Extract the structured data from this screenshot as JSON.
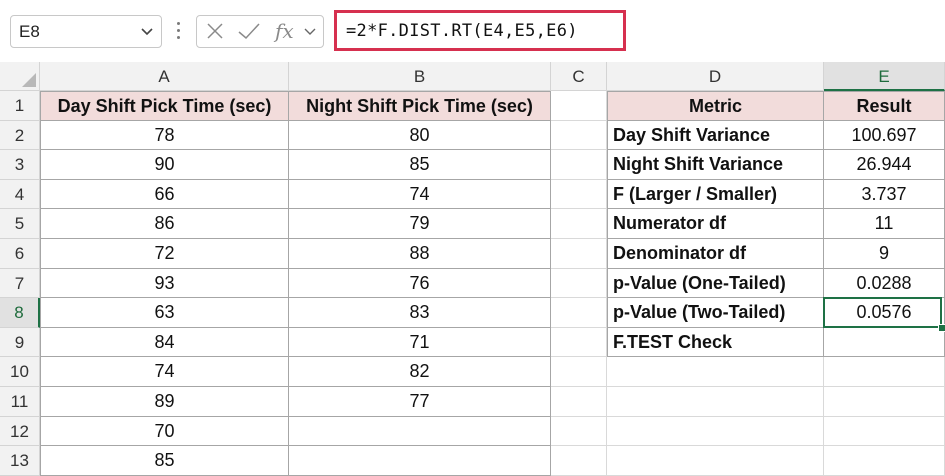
{
  "formula_bar": {
    "name_box": "E8",
    "cancel_icon": "cancel-icon",
    "enter_icon": "check-icon",
    "fx_label": "fx",
    "formula": "=2*F.DIST.RT(E4,E5,E6)",
    "highlight_color": "#d6304f"
  },
  "columns": [
    "A",
    "B",
    "C",
    "D",
    "E"
  ],
  "selected_column": "E",
  "rows": [
    "1",
    "2",
    "3",
    "4",
    "5",
    "6",
    "7",
    "8",
    "9",
    "10",
    "11",
    "12",
    "13"
  ],
  "selected_row": "8",
  "pick_times": {
    "header_a": "Day Shift Pick Time (sec)",
    "header_b": "Night Shift Pick Time (sec)",
    "day": [
      "78",
      "90",
      "66",
      "86",
      "72",
      "93",
      "63",
      "84",
      "74",
      "89",
      "70",
      "85"
    ],
    "night": [
      "80",
      "85",
      "74",
      "79",
      "88",
      "76",
      "83",
      "71",
      "82",
      "77",
      "",
      ""
    ]
  },
  "summary": {
    "header_metric": "Metric",
    "header_result": "Result",
    "rows": [
      {
        "metric": "Day Shift Variance",
        "result": "100.697"
      },
      {
        "metric": "Night Shift Variance",
        "result": "26.944"
      },
      {
        "metric": "F (Larger / Smaller)",
        "result": "3.737"
      },
      {
        "metric": "Numerator df",
        "result": "11"
      },
      {
        "metric": "Denominator df",
        "result": "9"
      },
      {
        "metric": "p-Value (One-Tailed)",
        "result": "0.0288"
      },
      {
        "metric": "p-Value (Two-Tailed)",
        "result": "0.0576"
      },
      {
        "metric": "F.TEST Check",
        "result": ""
      }
    ]
  },
  "colors": {
    "header_fill": "#f2dcdb",
    "selection": "#1e7145"
  }
}
